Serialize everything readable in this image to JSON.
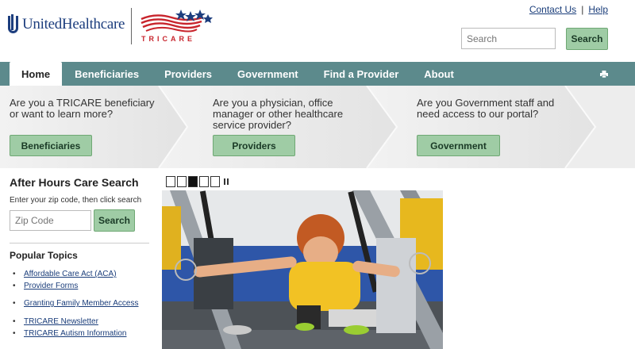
{
  "header": {
    "uhc_logo_text": "UnitedHealthcare",
    "tricare_logo_text": "TRICARE",
    "contact_us": "Contact Us",
    "separator": "|",
    "help": "Help",
    "search_placeholder": "Search",
    "search_button": "Search"
  },
  "nav": {
    "tabs": [
      {
        "label": "Home",
        "active": true
      },
      {
        "label": "Beneficiaries"
      },
      {
        "label": "Providers"
      },
      {
        "label": "Government"
      },
      {
        "label": "Find a Provider"
      },
      {
        "label": "About"
      }
    ],
    "print_icon": "printer-icon"
  },
  "audiences": [
    {
      "question": "Are you a TRICARE beneficiary or want to learn more?",
      "button": "Beneficiaries"
    },
    {
      "question": "Are you a physician, office manager or other healthcare service provider?",
      "button": "Providers"
    },
    {
      "question": "Are you Government staff and need access to our portal?",
      "button": "Government"
    }
  ],
  "sidebar": {
    "title": "After Hours Care Search",
    "instruction": "Enter your zip code, then click search",
    "zip_placeholder": "Zip Code",
    "zip_button": "Search",
    "topics_title": "Popular Topics",
    "topics": [
      "Affordable Care Act (ACA)",
      "Provider Forms",
      "Granting Family Member Access",
      "TRICARE Newsletter",
      "TRICARE Autism Information"
    ]
  },
  "carousel": {
    "slides": 5,
    "active_slide": 3
  },
  "colors": {
    "nav_bg": "#5c8a8c",
    "button_green": "#9fcca5",
    "brand_blue": "#1d3e7e",
    "brand_red": "#c8242c"
  }
}
